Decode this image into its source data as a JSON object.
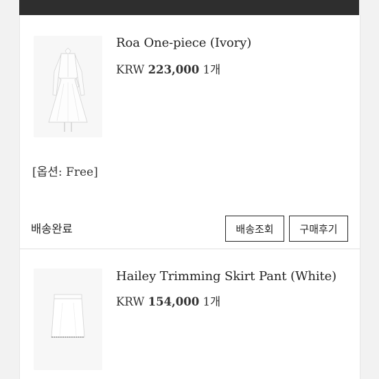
{
  "orders": [
    {
      "product_name": "Roa One-piece (Ivory)",
      "currency": "KRW",
      "price": "223,000",
      "quantity": "1개",
      "option": "[옵션: Free]",
      "status": "배송완료",
      "track_button": "배송조회",
      "review_button": "구매후기",
      "thumbnail_icon": "white-dress-icon"
    },
    {
      "product_name": "Hailey Trimming Skirt Pant (White)",
      "currency": "KRW",
      "price": "154,000",
      "quantity": "1개",
      "thumbnail_icon": "white-skirt-icon"
    }
  ],
  "colors": {
    "header_bar": "#2e2e2e",
    "card_bg": "#ffffff",
    "page_bg": "#f2f2f2",
    "button_border": "#222222"
  }
}
